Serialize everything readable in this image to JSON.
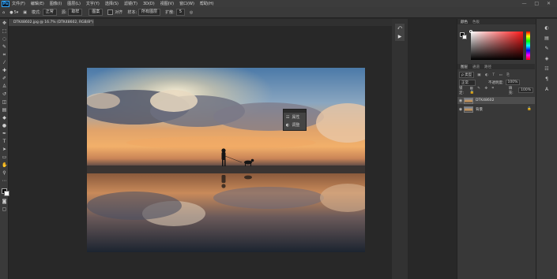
{
  "app": {
    "logo": "Ps"
  },
  "menubar": {
    "items": [
      "文件(F)",
      "编辑(E)",
      "图像(I)",
      "图层(L)",
      "文字(Y)",
      "选择(S)",
      "滤镜(T)",
      "3D(D)",
      "视图(V)",
      "窗口(W)",
      "帮助(H)"
    ],
    "window_controls": "—  □  ✕"
  },
  "optionsbar": {
    "size": "5",
    "mode_label": "模式:",
    "mode_value": "正常",
    "source_label": "源:",
    "source_value": "取样",
    "pattern_value": "图案",
    "aligned_label": "对齐",
    "sample_label": "样本:",
    "sample_value": "所有图层",
    "diffusion_label": "扩散:",
    "diffusion_value": "5"
  },
  "document": {
    "tab_title": "DTK48602.jpg @ 16.7% (DTK48602, RGB/8*) ×"
  },
  "context_panel": {
    "items": [
      "属性",
      "调整"
    ]
  },
  "color_panel": {
    "tabs": [
      "颜色",
      "色板"
    ],
    "colors": {
      "primary": "#000000",
      "secondary": "#ffffff",
      "hue_field": "#ff0000"
    }
  },
  "layers_panel": {
    "tabs": [
      "图层",
      "通道",
      "路径"
    ],
    "filter_label": "ρ 类型",
    "blend_mode": "正常",
    "opacity_label": "不透明度:",
    "opacity_value": "100%",
    "lock_label": "锁定:",
    "fill_label": "填充:",
    "fill_value": "100%",
    "layers": [
      {
        "name": "DTK48602",
        "visible": true,
        "selected": true
      },
      {
        "name": "背景",
        "visible": true,
        "selected": false
      }
    ]
  },
  "colors": {
    "ui_dark": "#282828",
    "panel": "#383838",
    "selection": "#4d4d4d",
    "accent": "#31a8ff"
  }
}
